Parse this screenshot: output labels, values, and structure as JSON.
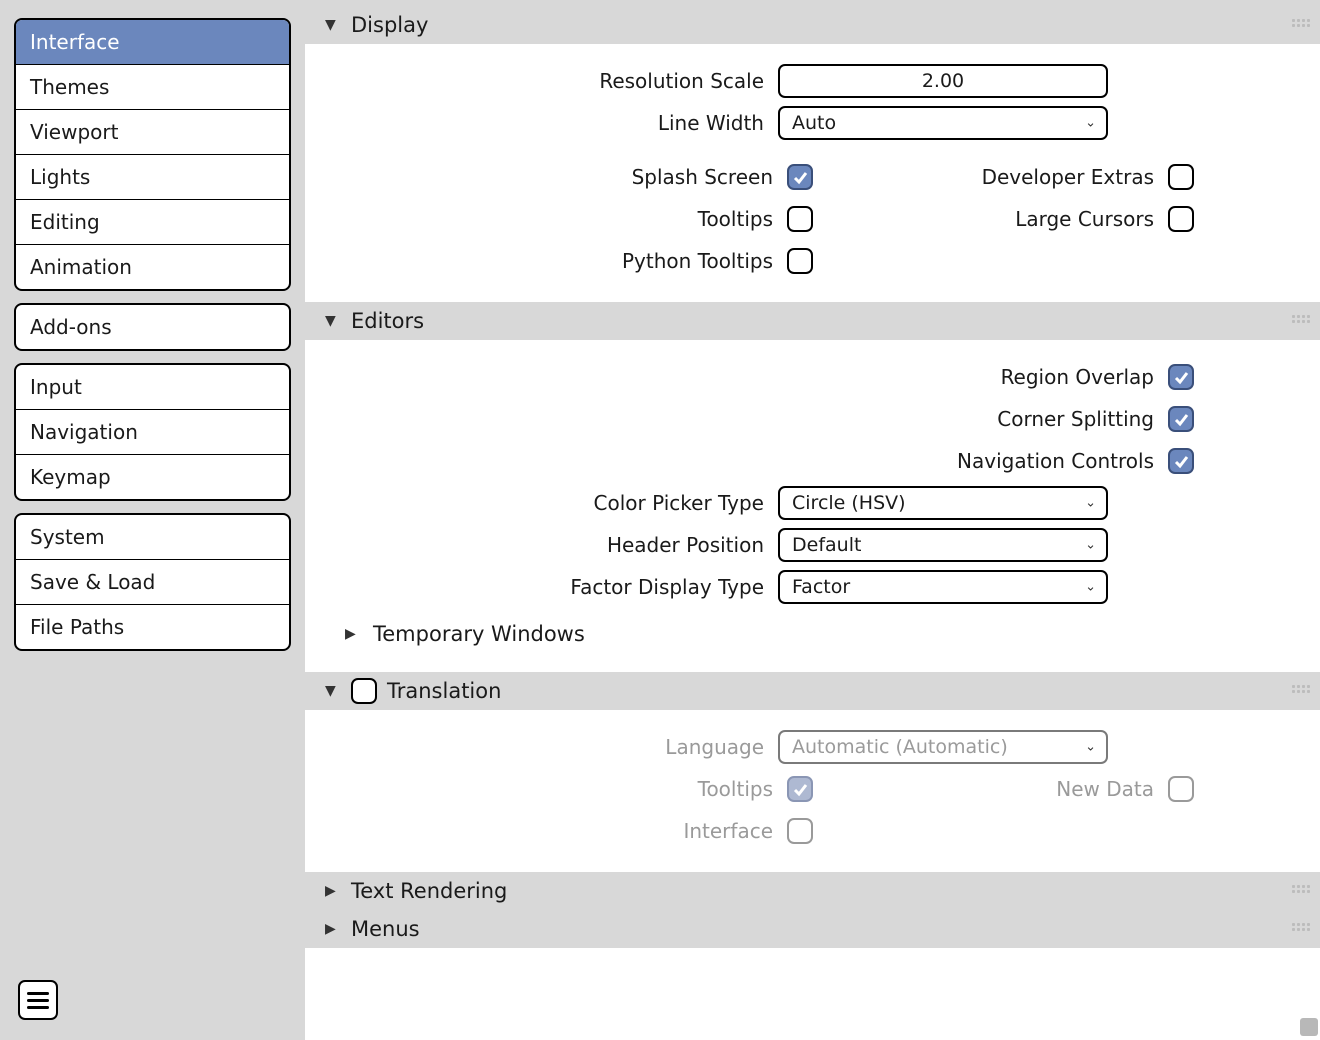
{
  "sidebar": {
    "groups": [
      {
        "items": [
          "Interface",
          "Themes",
          "Viewport",
          "Lights",
          "Editing",
          "Animation"
        ]
      },
      {
        "items": [
          "Add-ons"
        ]
      },
      {
        "items": [
          "Input",
          "Navigation",
          "Keymap"
        ]
      },
      {
        "items": [
          "System",
          "Save & Load",
          "File Paths"
        ]
      }
    ],
    "selected": "Interface"
  },
  "sections": {
    "display": {
      "title": "Display",
      "expanded": true,
      "resolution_scale": {
        "label": "Resolution Scale",
        "value": "2.00"
      },
      "line_width": {
        "label": "Line Width",
        "value": "Auto"
      },
      "splash_screen": {
        "label": "Splash Screen",
        "checked": true
      },
      "developer_extras": {
        "label": "Developer Extras",
        "checked": false
      },
      "tooltips": {
        "label": "Tooltips",
        "checked": false
      },
      "large_cursors": {
        "label": "Large Cursors",
        "checked": false
      },
      "python_tooltips": {
        "label": "Python Tooltips",
        "checked": false
      }
    },
    "editors": {
      "title": "Editors",
      "expanded": true,
      "region_overlap": {
        "label": "Region Overlap",
        "checked": true
      },
      "corner_splitting": {
        "label": "Corner Splitting",
        "checked": true
      },
      "navigation_controls": {
        "label": "Navigation Controls",
        "checked": true
      },
      "color_picker_type": {
        "label": "Color Picker Type",
        "value": "Circle (HSV)"
      },
      "header_position": {
        "label": "Header Position",
        "value": "Default"
      },
      "factor_display_type": {
        "label": "Factor Display Type",
        "value": "Factor"
      },
      "temporary_windows": {
        "label": "Temporary Windows",
        "expanded": false
      }
    },
    "translation": {
      "title": "Translation",
      "expanded": true,
      "enabled": false,
      "language": {
        "label": "Language",
        "value": "Automatic (Automatic)"
      },
      "tooltips": {
        "label": "Tooltips",
        "checked": true
      },
      "new_data": {
        "label": "New Data",
        "checked": false
      },
      "interface": {
        "label": "Interface",
        "checked": false
      }
    },
    "text_rendering": {
      "title": "Text Rendering",
      "expanded": false
    },
    "menus": {
      "title": "Menus",
      "expanded": false
    }
  }
}
